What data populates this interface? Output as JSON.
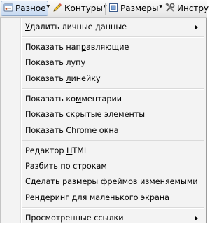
{
  "toolbar": {
    "misc": {
      "label": "Разное",
      "icon": "misc-icon"
    },
    "outlines": {
      "label": "Контуры",
      "icon": "pencil-icon"
    },
    "sizes": {
      "label": "Размеры",
      "icon": "resize-icon"
    },
    "tools": {
      "label": "Инстру",
      "icon": "tools-icon"
    }
  },
  "menu": {
    "groups": [
      [
        {
          "before": "",
          "underline": "У",
          "after": "далить личные данные",
          "submenu": true
        }
      ],
      [
        {
          "before": "Показать нап",
          "underline": "р",
          "after": "авляющие"
        },
        {
          "before": "П",
          "underline": "о",
          "after": "казать лупу"
        },
        {
          "before": "Показать ",
          "underline": "л",
          "after": "инейку"
        }
      ],
      [
        {
          "before": "Показать ко",
          "underline": "м",
          "after": "ментарии"
        },
        {
          "before": "Показать ск",
          "underline": "р",
          "after": "ытые элементы"
        },
        {
          "before": "Пок",
          "underline": "а",
          "after": "зать Chrome окна"
        }
      ],
      [
        {
          "before": "Редактор ",
          "underline": "H",
          "after": "TML"
        },
        {
          "before": "Разбить по строкам",
          "underline": "",
          "after": ""
        },
        {
          "before": "Сделать размеры фреймов изменяемыми",
          "underline": "",
          "after": ""
        },
        {
          "before": "Рендеринг для маленького экрана",
          "underline": "",
          "after": ""
        }
      ],
      [
        {
          "before": "Просмотренные ссылки",
          "underline": "",
          "after": "",
          "submenu": true
        }
      ]
    ]
  }
}
